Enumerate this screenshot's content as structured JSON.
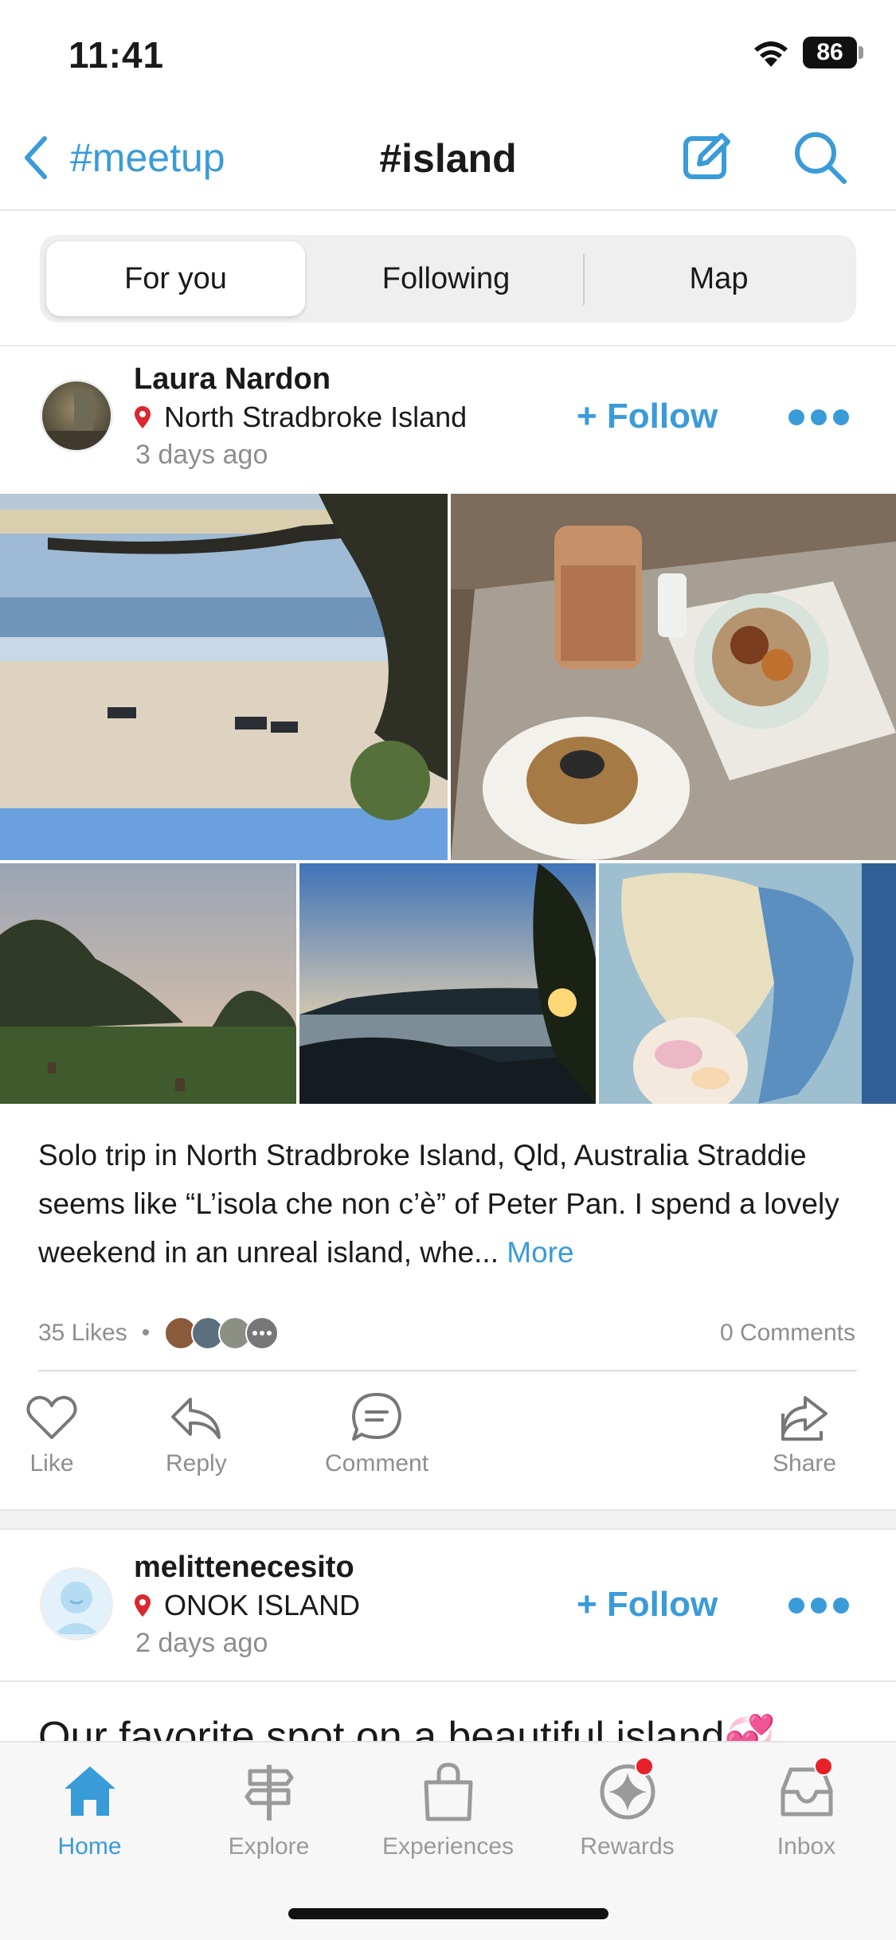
{
  "status_bar": {
    "time": "11:41",
    "battery": "86"
  },
  "nav": {
    "back_label": "#meetup",
    "title": "#island"
  },
  "segments": [
    "For you",
    "Following",
    "Map"
  ],
  "post1": {
    "username": "Laura Nardon",
    "location": "North Stradbroke Island",
    "time_ago": "3 days ago",
    "follow_label": "+ Follow",
    "caption": "Solo trip in North Stradbroke Island, Qld, Australia Straddie seems like “L’isola che non c’è” of Peter Pan. I spend a lovely weekend in an unreal island, whe...",
    "more_label": "More",
    "likes": "35 Likes",
    "comments": "0 Comments"
  },
  "actions": {
    "like": "Like",
    "reply": "Reply",
    "comment": "Comment",
    "share": "Share"
  },
  "post2": {
    "username": "melittenecesito",
    "location": "ONOK ISLAND",
    "time_ago": "2 days ago",
    "follow_label": "+ Follow",
    "caption_partial": "Our favorite spot on a beautiful island💞"
  },
  "tabs": {
    "home": "Home",
    "explore": "Explore",
    "experiences": "Experiences",
    "rewards": "Rewards",
    "inbox": "Inbox"
  },
  "colors": {
    "accent": "#3a9bd9",
    "badge": "#e8202a",
    "pin": "#d9282f"
  }
}
